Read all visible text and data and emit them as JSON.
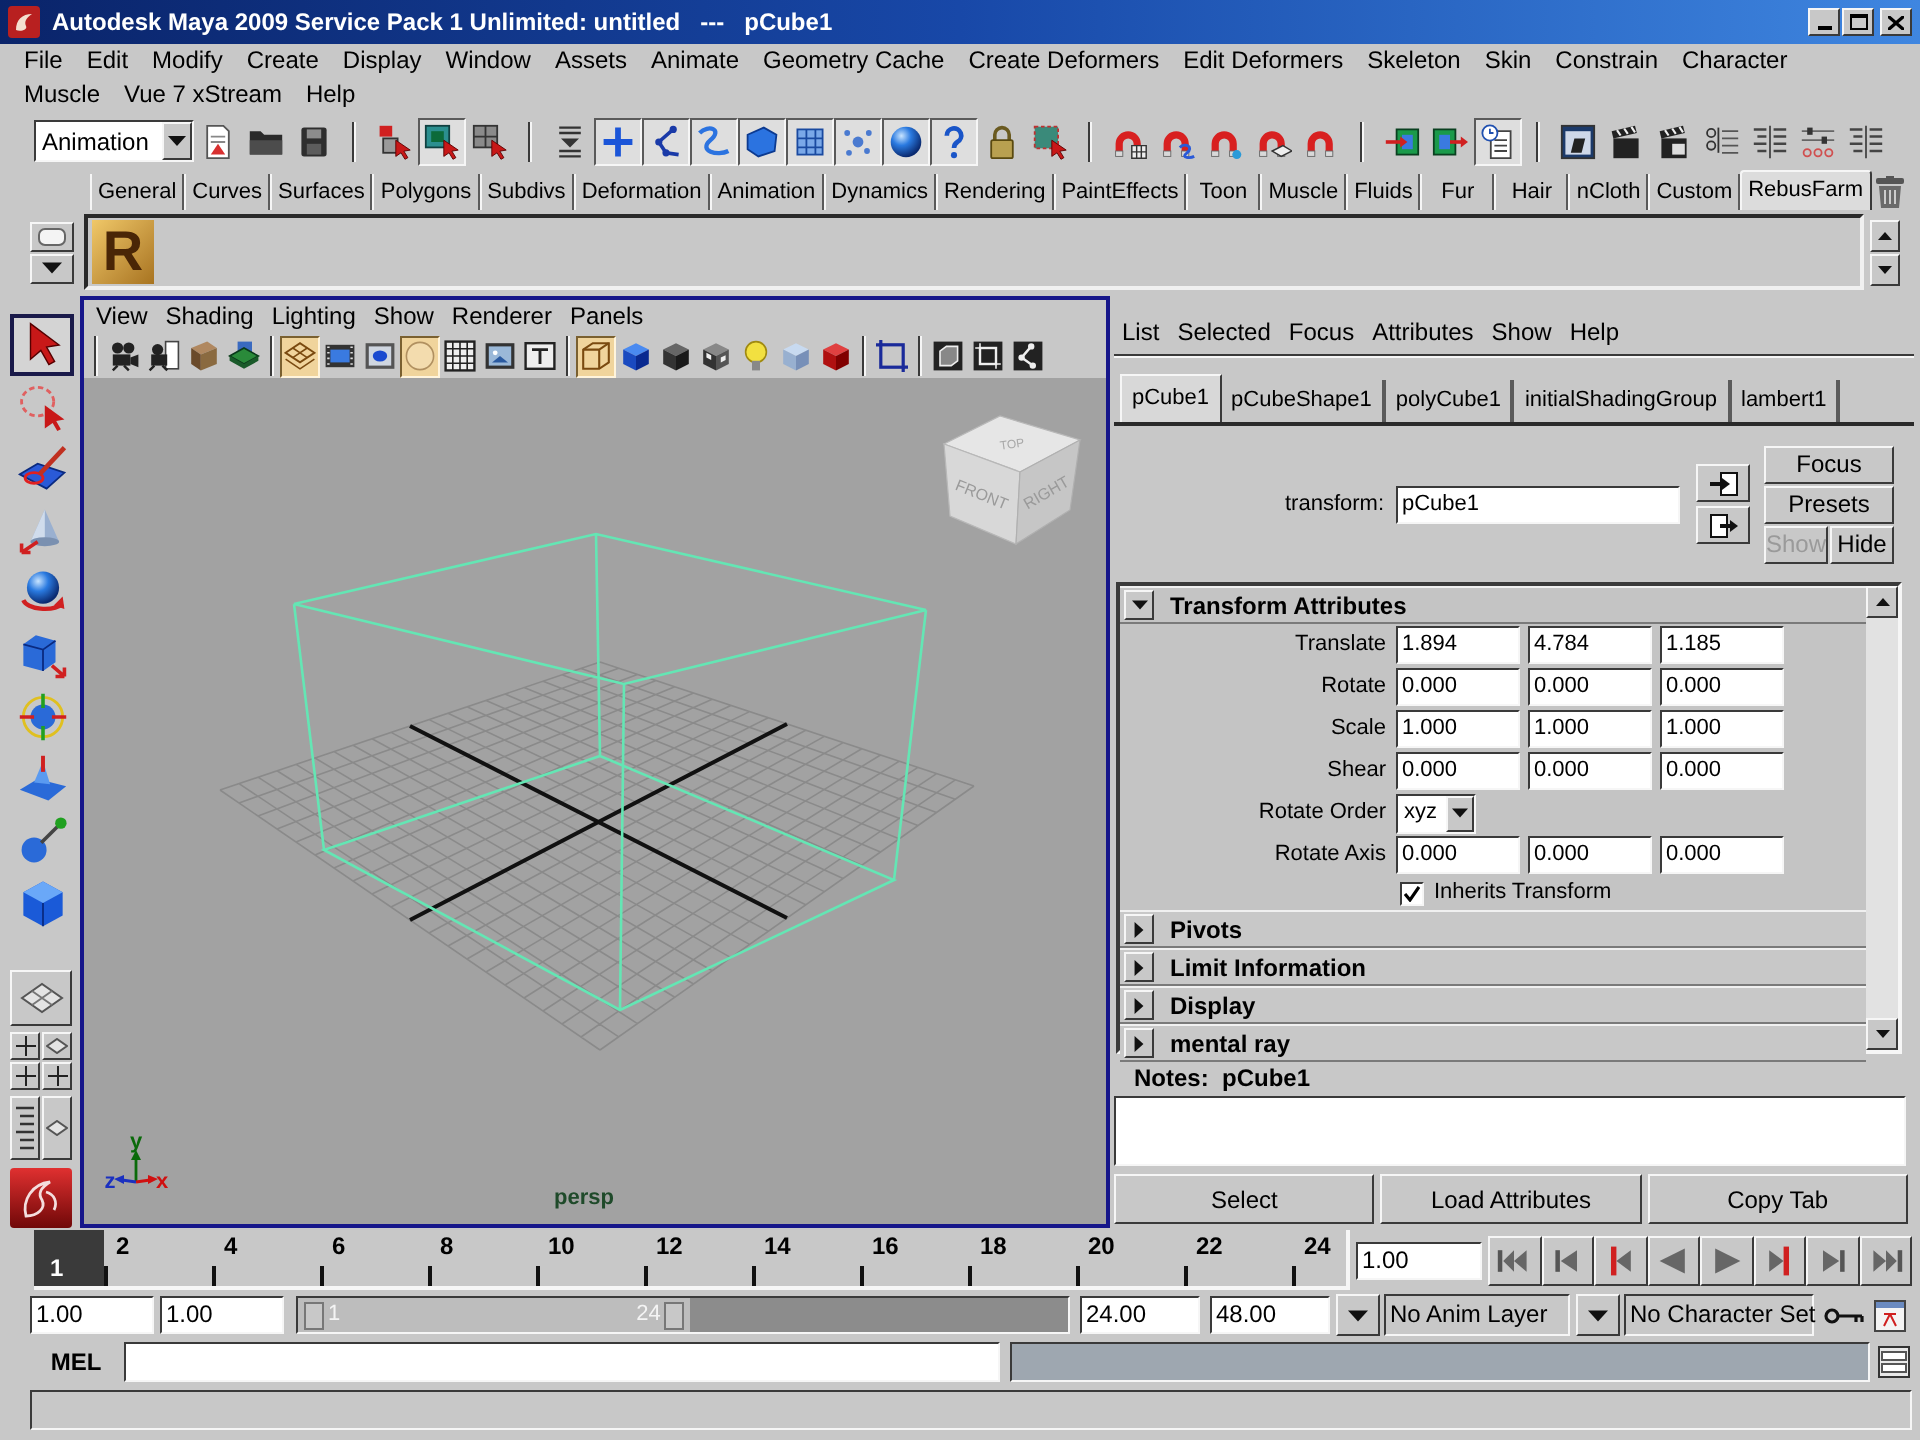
{
  "window": {
    "title": "Autodesk Maya 2009 Service Pack 1 Unlimited: untitled   ---   pCube1"
  },
  "menu_bar": {
    "items": [
      "File",
      "Edit",
      "Modify",
      "Create",
      "Display",
      "Window",
      "Assets",
      "Animate",
      "Geometry Cache",
      "Create Deformers",
      "Edit Deformers",
      "Skeleton",
      "Skin",
      "Constrain",
      "Character",
      "Muscle",
      "Vue 7 xStream",
      "Help"
    ]
  },
  "status_line": {
    "menu_set": "Animation",
    "buttons": [
      {
        "pressed": false
      },
      {
        "pressed": false
      },
      {
        "pressed": false
      },
      {
        "pressed": false
      },
      {
        "pressed": true
      },
      {
        "pressed": false
      },
      {
        "pressed": false
      },
      {
        "pressed": true
      },
      {
        "pressed": true
      },
      {
        "pressed": true
      },
      {
        "pressed": true
      },
      {
        "pressed": true
      },
      {
        "pressed": true
      },
      {
        "pressed": true
      },
      {
        "pressed": true
      },
      {
        "pressed": false
      },
      {
        "pressed": false
      },
      {
        "pressed": false
      },
      {
        "pressed": false
      },
      {
        "pressed": false
      },
      {
        "pressed": false
      },
      {
        "pressed": false
      },
      {
        "pressed": false
      },
      {
        "pressed": false
      },
      {
        "pressed": true
      },
      {
        "pressed": false
      },
      {
        "pressed": false
      },
      {
        "pressed": false
      },
      {
        "pressed": false
      },
      {
        "pressed": false
      },
      {
        "pressed": false
      },
      {
        "pressed": false
      }
    ]
  },
  "shelf": {
    "tabs": [
      {
        "label": "General",
        "selected": false
      },
      {
        "label": "Curves",
        "selected": false
      },
      {
        "label": "Surfaces",
        "selected": false
      },
      {
        "label": "Polygons",
        "selected": false
      },
      {
        "label": "Subdivs",
        "selected": false
      },
      {
        "label": "Deformation",
        "selected": false
      },
      {
        "label": "Animation",
        "selected": false
      },
      {
        "label": "Dynamics",
        "selected": false
      },
      {
        "label": "Rendering",
        "selected": false
      },
      {
        "label": "PaintEffects",
        "selected": false
      },
      {
        "label": "Toon",
        "selected": false
      },
      {
        "label": "Muscle",
        "selected": false
      },
      {
        "label": "Fluids",
        "selected": false
      },
      {
        "label": "Fur",
        "selected": false
      },
      {
        "label": "Hair",
        "selected": false
      },
      {
        "label": "nCloth",
        "selected": false
      },
      {
        "label": "Custom",
        "selected": false
      },
      {
        "label": "RebusFarm",
        "selected": true
      }
    ],
    "buttons": [
      {
        "label": "R"
      }
    ]
  },
  "toolbox": {
    "tools": [
      {
        "selected": true
      },
      {
        "selected": false
      },
      {
        "selected": false
      },
      {
        "selected": false
      },
      {
        "selected": false
      },
      {
        "selected": false
      },
      {
        "selected": false
      },
      {
        "selected": false
      },
      {
        "selected": false
      },
      {
        "selected": false
      }
    ]
  },
  "viewport": {
    "menu": [
      "View",
      "Shading",
      "Lighting",
      "Show",
      "Renderer",
      "Panels"
    ],
    "toolbar": [
      {
        "pressed": false
      },
      {
        "pressed": false
      },
      {
        "pressed": false
      },
      {
        "pressed": false
      },
      {
        "pressed": true
      },
      {
        "pressed": false
      },
      {
        "pressed": false
      },
      {
        "pressed": true
      },
      {
        "pressed": false
      },
      {
        "pressed": false
      },
      {
        "pressed": false
      },
      {
        "pressed": true
      },
      {
        "pressed": false
      },
      {
        "pressed": false
      },
      {
        "pressed": false
      },
      {
        "pressed": false
      },
      {
        "pressed": false
      },
      {
        "pressed": false
      },
      {
        "pressed": false
      },
      {
        "pressed": false
      },
      {
        "pressed": false
      },
      {
        "pressed": false
      }
    ],
    "view_cube": [
      "TOP",
      "FRONT",
      "RIGHT"
    ],
    "axis_labels": [
      "y",
      "z",
      "x"
    ],
    "camera": "persp"
  },
  "attribute_editor": {
    "menu": [
      "List",
      "Selected",
      "Focus",
      "Attributes",
      "Show",
      "Help"
    ],
    "tabs": [
      {
        "label": "pCube1",
        "selected": true
      },
      {
        "label": "pCubeShape1",
        "selected": false
      },
      {
        "label": "polyCube1",
        "selected": false
      },
      {
        "label": "initialShadingGroup",
        "selected": false
      },
      {
        "label": "lambert1",
        "selected": false
      }
    ],
    "node_type_label": "transform:",
    "node_name": "pCube1",
    "buttons": [
      {
        "label": "Focus",
        "disabled": false
      },
      {
        "label": "Presets",
        "disabled": false
      },
      {
        "label": "Show",
        "disabled": true
      },
      {
        "label": "Hide",
        "disabled": false
      }
    ],
    "sections": [
      {
        "title": "Transform Attributes",
        "expanded": true,
        "rows": [
          {
            "kind": "vector",
            "label": "Translate",
            "values": [
              "1.894",
              "4.784",
              "1.185"
            ]
          },
          {
            "kind": "vector",
            "label": "Rotate",
            "values": [
              "0.000",
              "0.000",
              "0.000"
            ]
          },
          {
            "kind": "vector",
            "label": "Scale",
            "values": [
              "1.000",
              "1.000",
              "1.000"
            ]
          },
          {
            "kind": "vector",
            "label": "Shear",
            "values": [
              "0.000",
              "0.000",
              "0.000"
            ]
          },
          {
            "kind": "enum",
            "label": "Rotate Order",
            "value": "xyz"
          },
          {
            "kind": "vector",
            "label": "Rotate Axis",
            "values": [
              "0.000",
              "0.000",
              "0.000"
            ]
          },
          {
            "kind": "checkbox",
            "label": "Inherits Transform",
            "checked": true
          }
        ]
      },
      {
        "title": "Pivots",
        "expanded": false
      },
      {
        "title": "Limit Information",
        "expanded": false
      },
      {
        "title": "Display",
        "expanded": false
      },
      {
        "title": "mental ray",
        "expanded": false
      }
    ],
    "notes_label": "Notes:  pCube1",
    "footer_buttons": [
      "Select",
      "Load Attributes",
      "Copy Tab"
    ]
  },
  "time_slider": {
    "current_frame": "1",
    "labels": [
      "2",
      "4",
      "6",
      "8",
      "10",
      "12",
      "14",
      "16",
      "18",
      "20",
      "22",
      "24"
    ],
    "current_time": "1.00"
  },
  "range_slider": {
    "start_time": "1.00",
    "playback_start": "1.00",
    "range_start": "1",
    "range_end": "24",
    "level": 0.51,
    "playback_end": "24.00",
    "end_time": "48.00",
    "anim_layer": "No Anim Layer",
    "character_set": "No Character Set"
  },
  "command_line": {
    "language": "MEL"
  }
}
